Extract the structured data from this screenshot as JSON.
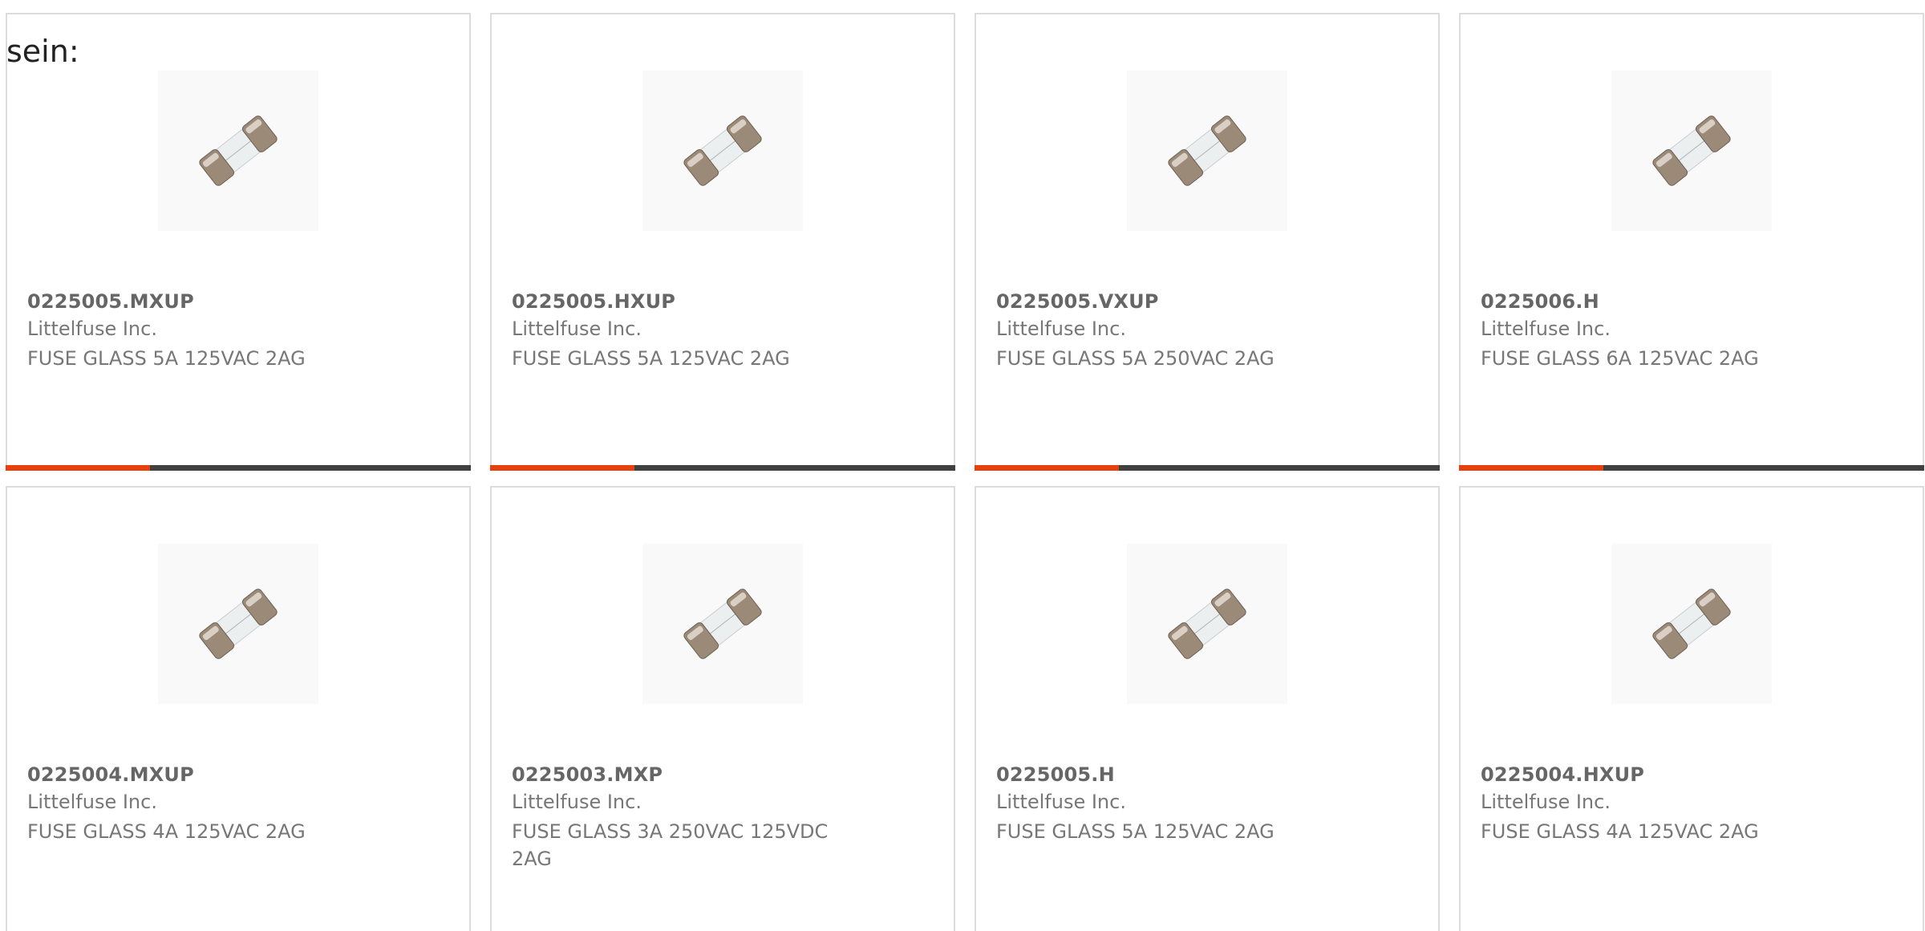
{
  "lead_text": "sein:",
  "accent_color": "#e8400c",
  "bar_color": "#404040",
  "products": [
    {
      "part_number": "0225005.MXUP",
      "manufacturer": "Littelfuse Inc.",
      "description": "FUSE GLASS 5A 125VAC 2AG",
      "image_icon": "glass-fuse-icon",
      "progress": 0.31
    },
    {
      "part_number": "0225005.HXUP",
      "manufacturer": "Littelfuse Inc.",
      "description": "FUSE GLASS 5A 125VAC 2AG",
      "image_icon": "glass-fuse-icon",
      "progress": 0.31
    },
    {
      "part_number": "0225005.VXUP",
      "manufacturer": "Littelfuse Inc.",
      "description": "FUSE GLASS 5A 250VAC 2AG",
      "image_icon": "glass-fuse-icon",
      "progress": 0.31
    },
    {
      "part_number": "0225006.H",
      "manufacturer": "Littelfuse Inc.",
      "description": "FUSE GLASS 6A 125VAC 2AG",
      "image_icon": "glass-fuse-icon",
      "progress": 0.31
    },
    {
      "part_number": "0225004.MXUP",
      "manufacturer": "Littelfuse Inc.",
      "description": "FUSE GLASS 4A 125VAC 2AG",
      "image_icon": "glass-fuse-icon"
    },
    {
      "part_number": "0225003.MXP",
      "manufacturer": "Littelfuse Inc.",
      "description": "FUSE GLASS 3A 250VAC 125VDC 2AG",
      "image_icon": "glass-fuse-icon"
    },
    {
      "part_number": "0225005.H",
      "manufacturer": "Littelfuse Inc.",
      "description": "FUSE GLASS 5A 125VAC 2AG",
      "image_icon": "glass-fuse-icon"
    },
    {
      "part_number": "0225004.HXUP",
      "manufacturer": "Littelfuse Inc.",
      "description": "FUSE GLASS 4A 125VAC 2AG",
      "image_icon": "glass-fuse-icon"
    }
  ]
}
